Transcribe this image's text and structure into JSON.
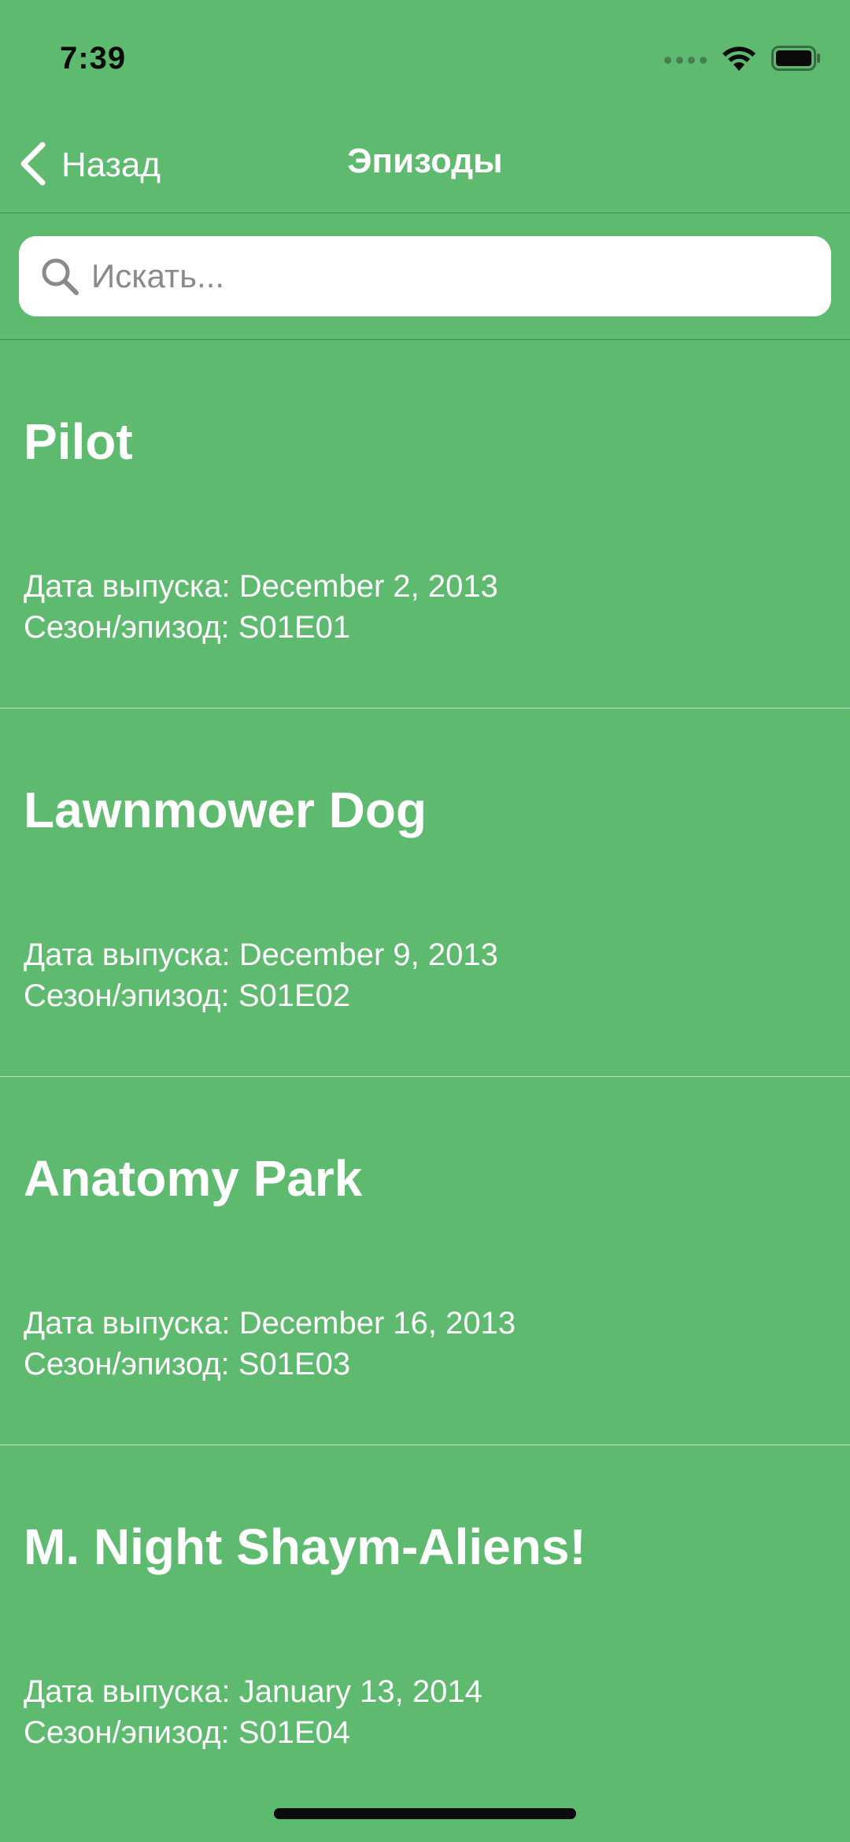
{
  "status_bar": {
    "time": "7:39"
  },
  "nav": {
    "back_label": "Назад",
    "title": "Эпизоды"
  },
  "search": {
    "placeholder": "Искать...",
    "value": ""
  },
  "episodes": [
    {
      "title": "Pilot",
      "release": "Дата выпуска: December 2, 2013",
      "code": "Сезон/эпизод: S01E01"
    },
    {
      "title": "Lawnmower Dog",
      "release": "Дата выпуска: December 9, 2013",
      "code": "Сезон/эпизод: S01E02"
    },
    {
      "title": "Anatomy Park",
      "release": "Дата выпуска: December 16, 2013",
      "code": "Сезон/эпизод: S01E03"
    },
    {
      "title": "M. Night Shaym-Aliens!",
      "release": "Дата выпуска: January 13, 2014",
      "code": "Сезон/эпизод: S01E04"
    }
  ],
  "colors": {
    "background": "#5dba6e",
    "text": "#ffffff",
    "search_background": "#ffffff",
    "placeholder": "#8a8a8e"
  },
  "icons": {
    "back": "chevron-left-icon",
    "search": "magnifier-icon",
    "wifi": "wifi-icon",
    "battery": "battery-icon",
    "signal": "cellular-signal-icon"
  }
}
